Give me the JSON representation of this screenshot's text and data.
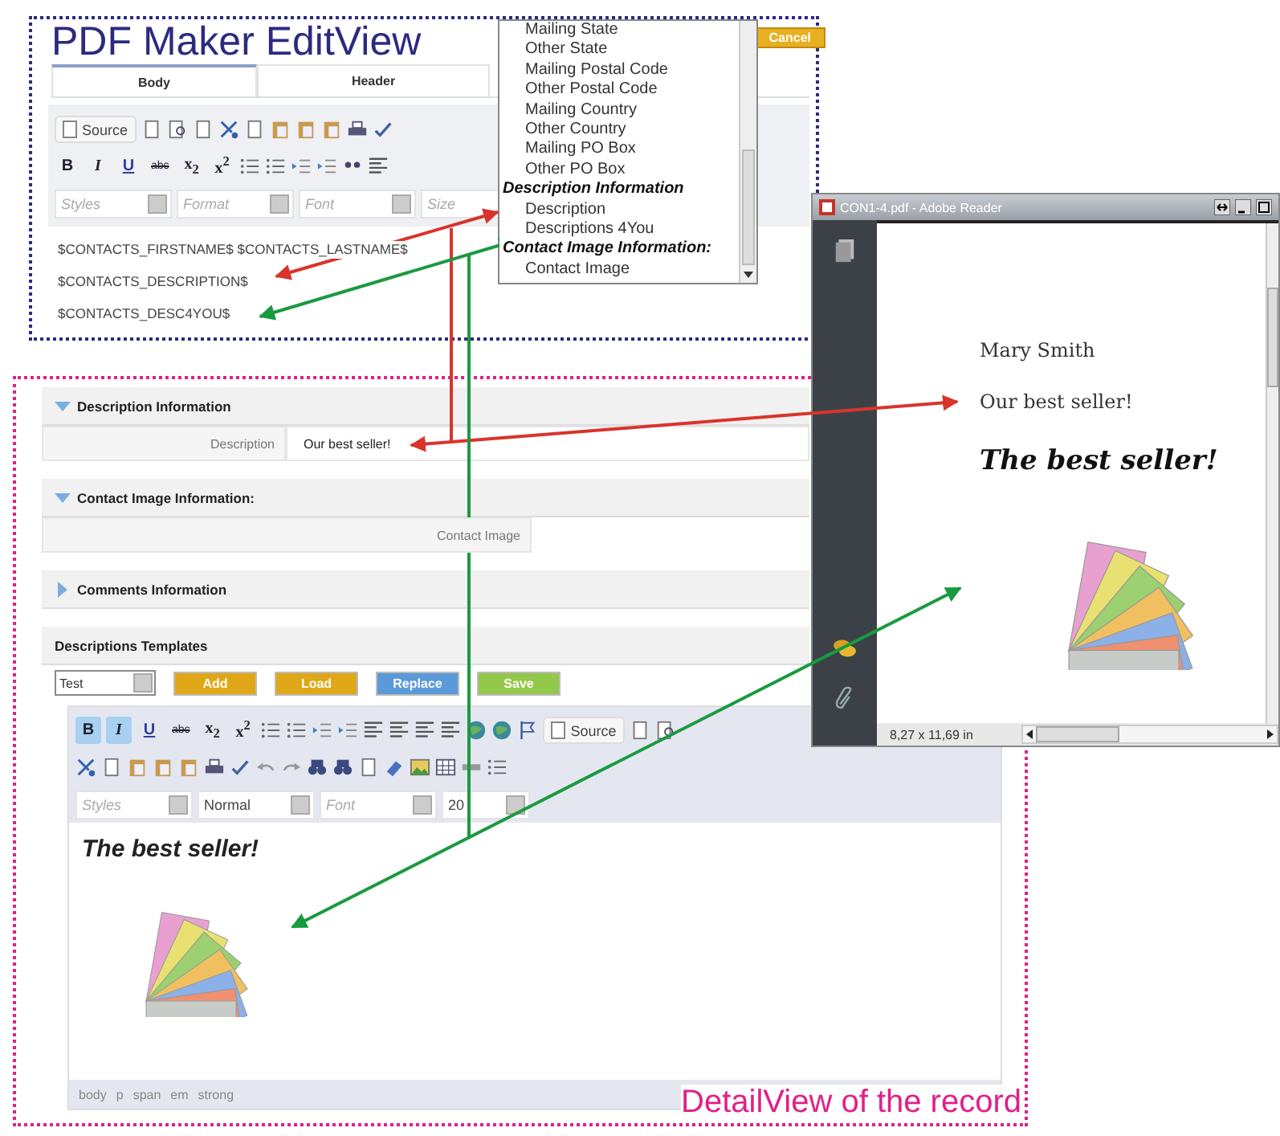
{
  "edit_view": {
    "title": "PDF Maker EditView",
    "cancel_button": "Cancel",
    "tabs": [
      {
        "label": "Body",
        "selected": true
      },
      {
        "label": "Header",
        "selected": false
      }
    ],
    "source_button": "Source",
    "format_buttons": [
      {
        "label": "B",
        "kind": "bold",
        "selected": false
      },
      {
        "label": "I",
        "kind": "italic",
        "selected": false
      },
      {
        "label": "U",
        "kind": "underline",
        "selected": false
      },
      {
        "label": "abc",
        "kind": "strike",
        "selected": false
      }
    ],
    "script_buttons": [
      "x$_{2}$",
      "x$^{2}$"
    ],
    "combos": [
      {
        "placeholder": "Styles"
      },
      {
        "placeholder": "Format"
      },
      {
        "placeholder": "Font"
      },
      {
        "placeholder": "Size"
      }
    ],
    "body_lines": [
      "$CONTACTS_FIRSTNAME$ $CONTACTS_LASTNAME$",
      "$CONTACTS_DESCRIPTION$",
      "$CONTACTS_DESC4YOU$"
    ]
  },
  "field_list": {
    "items": [
      {
        "label": "Mailing State",
        "kind": "option"
      },
      {
        "label": "Other State",
        "kind": "option"
      },
      {
        "label": "Mailing Postal Code",
        "kind": "option"
      },
      {
        "label": "Other Postal Code",
        "kind": "option"
      },
      {
        "label": "Mailing Country",
        "kind": "option"
      },
      {
        "label": "Other Country",
        "kind": "option"
      },
      {
        "label": "Mailing PO Box",
        "kind": "option"
      },
      {
        "label": "Other PO Box",
        "kind": "option"
      },
      {
        "label": "Description Information",
        "kind": "group"
      },
      {
        "label": "Description",
        "kind": "option"
      },
      {
        "label": "Descriptions 4You",
        "kind": "option"
      },
      {
        "label": "Contact Image Information:",
        "kind": "group"
      },
      {
        "label": "Contact Image",
        "kind": "option"
      }
    ]
  },
  "detail_view": {
    "caption": "DetailView of the record",
    "blocks": [
      {
        "title": "Description Information",
        "expanded": true,
        "fields": [
          {
            "label": "Description",
            "value": "Our best seller!"
          }
        ]
      },
      {
        "title": "Contact Image Information:",
        "expanded": true,
        "fields": [
          {
            "label": "Contact Image"
          }
        ]
      },
      {
        "title": "Comments Information",
        "expanded": false
      }
    ],
    "templates": {
      "title": "Descriptions Templates",
      "select": "Test",
      "buttons": [
        {
          "label": "Add",
          "color": "#e0a818"
        },
        {
          "label": "Load",
          "color": "#e0a818"
        },
        {
          "label": "Replace",
          "color": "#5a9ad8"
        },
        {
          "label": "Save",
          "color": "#94c84a"
        }
      ]
    },
    "editor": {
      "format_buttons": [
        {
          "label": "B",
          "kind": "bold",
          "selected": true
        },
        {
          "label": "I",
          "kind": "italic",
          "selected": true
        },
        {
          "label": "U",
          "kind": "underline",
          "selected": false
        },
        {
          "label": "abc",
          "kind": "strike",
          "selected": false
        }
      ],
      "script_buttons": [
        "x$_{2}$",
        "x$^{2}$"
      ],
      "source_button": "Source",
      "combos": [
        {
          "placeholder": "Styles"
        },
        {
          "value": "Normal"
        },
        {
          "placeholder": "Font"
        },
        {
          "value": "20"
        }
      ],
      "heading": "The best seller!",
      "path": [
        "body",
        "p",
        "span",
        "em",
        "strong"
      ]
    }
  },
  "pdf_window": {
    "title": "CON1-4.pdf - Adobe Reader",
    "lines": [
      "Mary Smith",
      "Our best seller!"
    ],
    "heading": "The best seller!",
    "page_size": "8,27 x 11,69 in"
  }
}
